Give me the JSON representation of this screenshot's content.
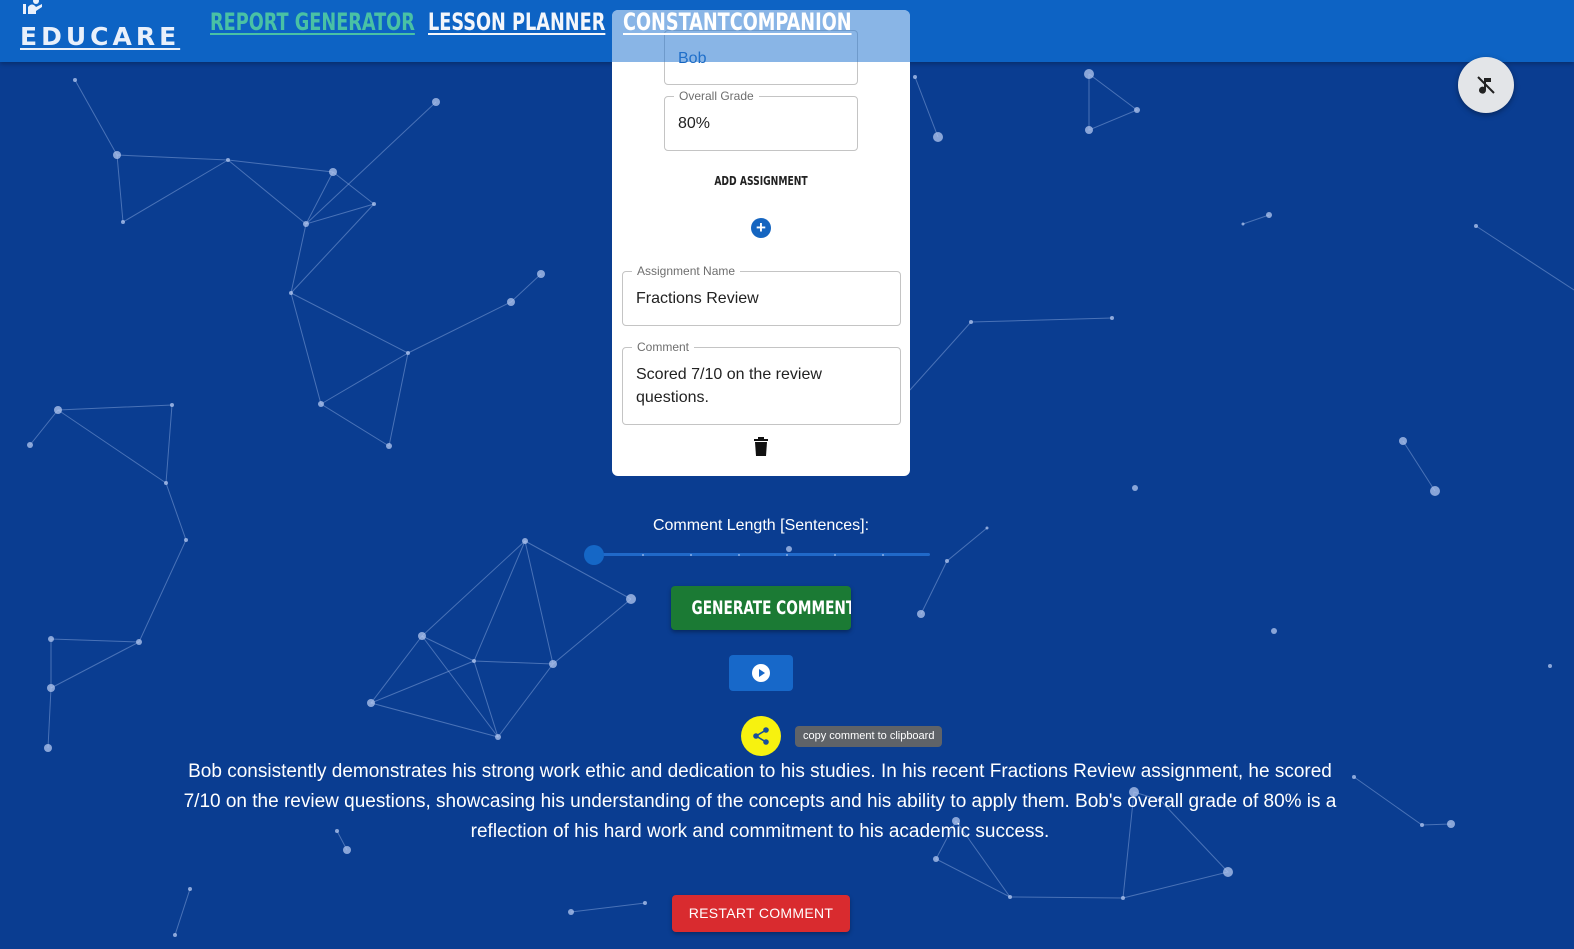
{
  "header": {
    "logo_text": "EDUCARE",
    "nav": [
      {
        "label": "REPORT GENERATOR"
      },
      {
        "label": "LESSON PLANNER"
      },
      {
        "label": "CONSTANTCOMPANION"
      }
    ]
  },
  "form": {
    "student_name_value": "Bob",
    "overall_grade_label": "Overall Grade",
    "overall_grade_value": "80%",
    "add_assignment_label": "ADD ASSIGNMENT",
    "assignment_name_label": "Assignment Name",
    "assignment_name_value": "Fractions Review",
    "comment_label": "Comment",
    "comment_value": "Scored 7/10 on the review questions."
  },
  "controls": {
    "comment_length_label": "Comment Length [Sentences]:",
    "comment_length_value": 1,
    "generate_label": "GENERATE COMMENT",
    "copy_tooltip": "copy comment to clipboard",
    "restart_label": "RESTART COMMENT"
  },
  "result_text": "Bob consistently demonstrates his strong work ethic and dedication to his studies. In his recent Fractions Review assignment, he scored 7/10 on the review questions, showcasing his understanding of the concepts and his ability to apply them. Bob's overall grade of 80% is a reflection of his hard work and commitment to his academic success.",
  "icons": [
    "logo-icon",
    "plus-icon",
    "trash-icon",
    "music-off-icon",
    "play-icon",
    "share-icon"
  ],
  "colors": {
    "background": "#0a3d91",
    "header": "#0d63c4",
    "active_nav": "#49c1a5",
    "generate": "#1b7a34",
    "share": "#f7f20f",
    "restart": "#d92b2f"
  }
}
